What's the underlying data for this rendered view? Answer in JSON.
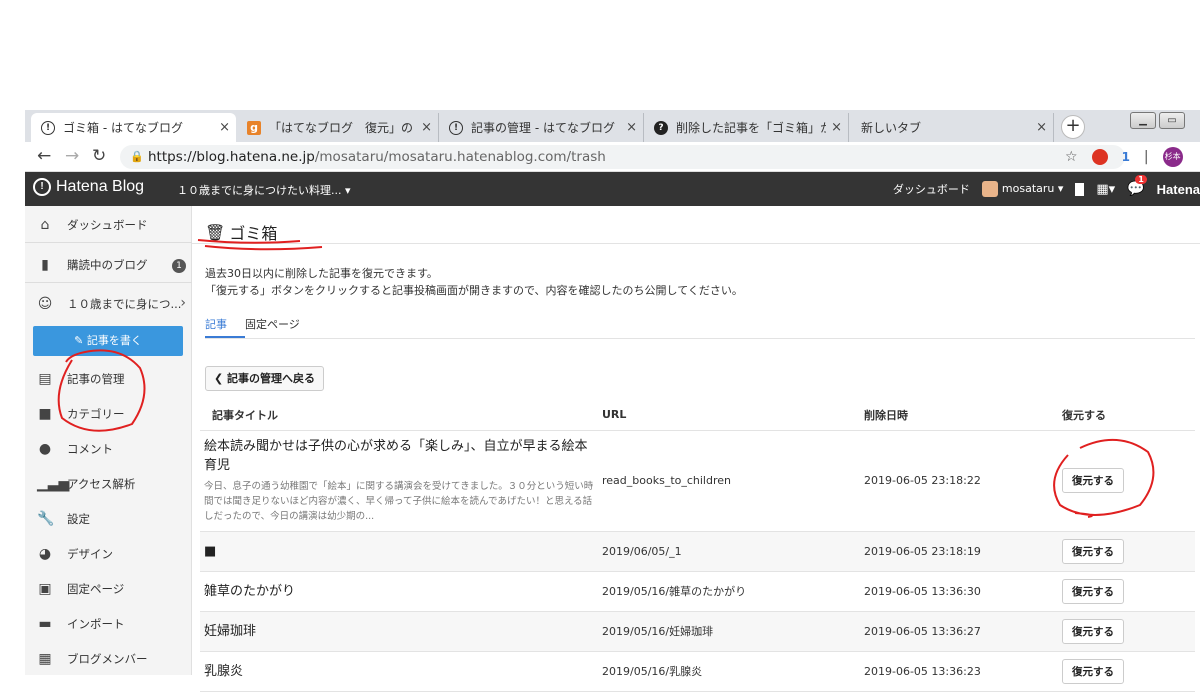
{
  "browser": {
    "tabs": [
      {
        "title": "ゴミ箱 - はてなブログ",
        "icon": "hatena-icon"
      },
      {
        "title": "「はてなブログ　復元」の",
        "icon": "google-icon"
      },
      {
        "title": "記事の管理 - はてなブログ",
        "icon": "hatena-icon"
      },
      {
        "title": "削除した記事を「ゴミ箱」から",
        "icon": "help-icon"
      },
      {
        "title": "新しいタブ",
        "icon": ""
      }
    ],
    "close_glyph": "×",
    "new_tab_glyph": "+",
    "url_host": "https://blog.hatena.ne.jp",
    "url_path": "/mosataru/mosataru.hatenablog.com/trash",
    "ext_badge": "1",
    "profile_text": "杉本"
  },
  "header": {
    "logo_text": "Hatena Blog",
    "blog_selector": "１０歳までに身につけたい料理... ▾",
    "dashboard": "ダッシュボード",
    "user": "mosataru ▾",
    "notif_count": "1",
    "brand": "Hatena"
  },
  "sidebar": {
    "items": [
      {
        "label": "ダッシュボード",
        "icon": "home-icon"
      },
      {
        "label": "購読中のブログ",
        "icon": "bookmark-icon",
        "badge": "1"
      },
      {
        "label": "１０歳までに身につ...",
        "icon": "avatar-icon"
      },
      {
        "label": "記事の管理",
        "icon": "document-icon"
      },
      {
        "label": "カテゴリー",
        "icon": "folder-icon"
      },
      {
        "label": "コメント",
        "icon": "comment-icon"
      },
      {
        "label": "アクセス解析",
        "icon": "chart-icon"
      },
      {
        "label": "設定",
        "icon": "wrench-icon"
      },
      {
        "label": "デザイン",
        "icon": "palette-icon"
      },
      {
        "label": "固定ページ",
        "icon": "page-icon"
      },
      {
        "label": "インポート",
        "icon": "truck-icon"
      },
      {
        "label": "ブログメンバー",
        "icon": "members-icon"
      }
    ],
    "write_button": "記事を書く"
  },
  "main": {
    "page_title": "ゴミ箱",
    "desc_line1": "過去30日以内に削除した記事を復元できます。",
    "desc_line2": "「復元する」ボタンをクリックすると記事投稿画面が開きますので、内容を確認したのち公開してください。",
    "tab_articles": "記事",
    "tab_fixed": "固定ページ",
    "back_button": "記事の管理へ戻る",
    "columns": [
      "記事タイトル",
      "URL",
      "削除日時",
      "復元する"
    ],
    "restore_label": "復元する",
    "rows": [
      {
        "title": "絵本読み聞かせは子供の心が求める「楽しみ」、自立が早まる絵本育児",
        "excerpt": "今日、息子の通う幼稚園で「絵本」に関する講演会を受けてきました。３０分という短い時間では聞き足りないほど内容が濃く、早く帰って子供に絵本を読んであげたい！と思える話しだったので、今日の講演は幼少期の...",
        "url": "read_books_to_children",
        "deleted": "2019-06-05 23:18:22"
      },
      {
        "title": "■",
        "excerpt": "",
        "url": "2019/06/05/_1",
        "deleted": "2019-06-05 23:18:19"
      },
      {
        "title": "雑草のたかがり",
        "excerpt": "",
        "url": "2019/05/16/雑草のたかがり",
        "deleted": "2019-06-05 13:36:30"
      },
      {
        "title": "妊婦珈琲",
        "excerpt": "",
        "url": "2019/05/16/妊婦珈琲",
        "deleted": "2019-06-05 13:36:27"
      },
      {
        "title": "乳腺炎",
        "excerpt": "",
        "url": "2019/05/16/乳腺炎",
        "deleted": "2019-06-05 13:36:23"
      }
    ]
  },
  "colors": {
    "accent": "#3a97de",
    "annotation": "#e02020",
    "header_bg": "#343434"
  }
}
